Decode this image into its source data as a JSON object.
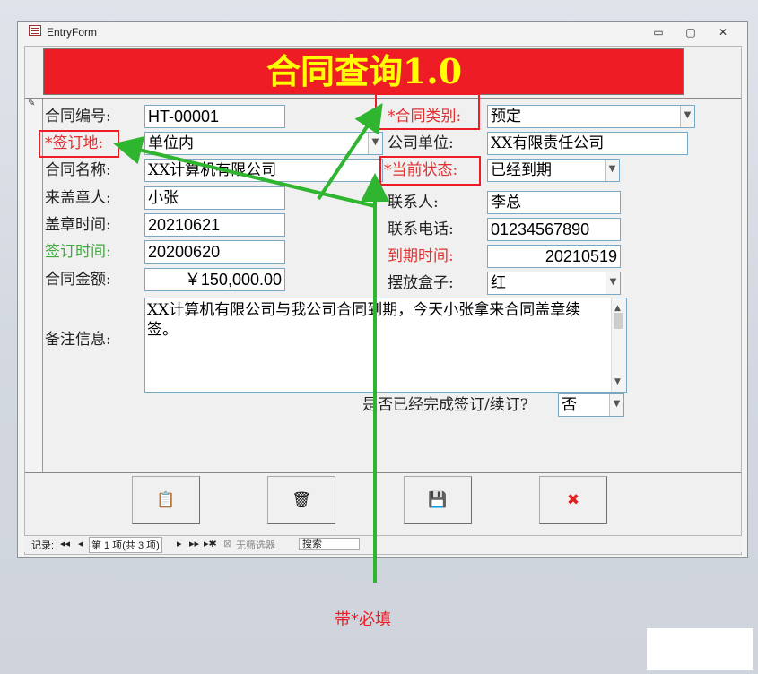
{
  "window": {
    "title": "EntryForm",
    "controls": {
      "minimize": "▭",
      "restore": "▢",
      "close": "✕"
    }
  },
  "header": {
    "title": "合同查询1.0",
    "bg_color": "#ee1c24",
    "text_color": "#ffff00"
  },
  "labels": {
    "contract_no": "合同编号:",
    "sign_place": "*签订地:",
    "contract_name": "合同名称:",
    "stamp_person": "来盖章人:",
    "stamp_time": "盖章时间:",
    "sign_time": "签订时间:",
    "amount": "合同金额:",
    "remarks": "备注信息:",
    "contract_type": "*合同类别:",
    "company": "公司单位:",
    "status": "*当前状态:",
    "contact": "联系人:",
    "phone": "联系电话:",
    "expire_time": "到期时间:",
    "box": "摆放盒子:",
    "completed": "是否已经完成签订/续订?"
  },
  "fields": {
    "contract_no": "HT-00001",
    "sign_place": "单位内",
    "contract_name": "XX计算机有限公司",
    "stamp_person": "小张",
    "stamp_time": "20210621",
    "sign_time": "20200620",
    "amount": "￥150,000.00",
    "remarks": "XX计算机有限公司与我公司合同到期，今天小张拿来合同盖章续签。",
    "contract_type": "预定",
    "company": "XX有限责任公司",
    "status": "已经到期",
    "contact": "李总",
    "phone": "01234567890",
    "expire_time": "20210519",
    "box": "红",
    "completed": "否"
  },
  "buttons": {
    "paste": {
      "icon": "paste-icon",
      "glyph": "📋"
    },
    "delete": {
      "icon": "trash-icon",
      "glyph": "🗑"
    },
    "save": {
      "icon": "save-icon",
      "glyph": "💾"
    },
    "close": {
      "icon": "close-circle-icon",
      "glyph": "✖"
    }
  },
  "navbar": {
    "record_label": "记录:",
    "first": "◂◂",
    "prev": "◂",
    "position": "第 1 项(共 3 项)",
    "next": "▸",
    "last": "▸▸",
    "new": "▸✱",
    "filter": "无筛选器",
    "search": "搜索"
  },
  "annotation": "带*必填",
  "colors": {
    "required_label": "#e03030",
    "green_label": "#3cae3c",
    "annotation_arrow": "#2fb52f"
  }
}
